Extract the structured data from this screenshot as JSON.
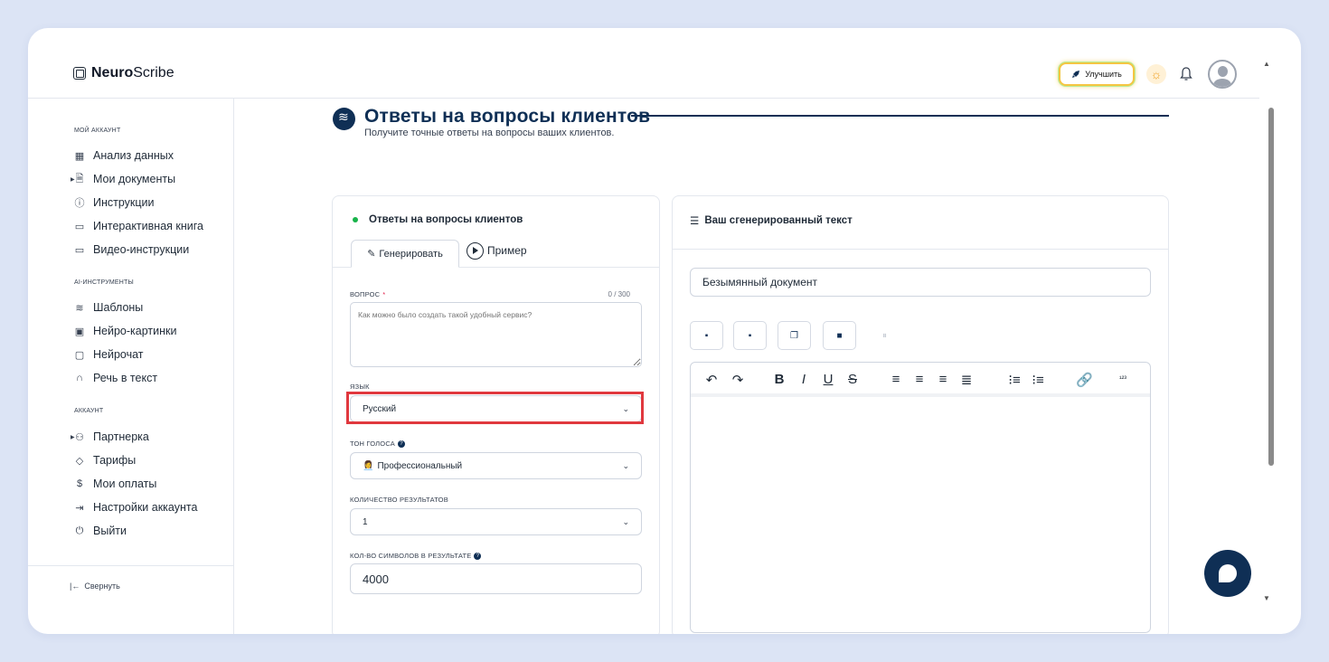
{
  "brand": {
    "bold": "Neuro",
    "light": "Scribe"
  },
  "header": {
    "upgrade_label": "Улучшить"
  },
  "sidebar": {
    "section_account": "МОЙ АККАУНТ",
    "account_items": [
      {
        "label": "Анализ данных",
        "icon": "grid-icon"
      },
      {
        "label": "Мои документы",
        "icon": "document-icon"
      },
      {
        "label": "Инструкции",
        "icon": "help-circle-icon"
      },
      {
        "label": "Интерактивная книга",
        "icon": "book-icon"
      },
      {
        "label": "Видео-инструкции",
        "icon": "video-icon"
      }
    ],
    "section_ai": "AI-ИНСТРУМЕНТЫ",
    "ai_items": [
      {
        "label": "Шаблоны",
        "icon": "layers-icon"
      },
      {
        "label": "Нейро-картинки",
        "icon": "image-icon"
      },
      {
        "label": "Нейрочат",
        "icon": "chat-icon"
      },
      {
        "label": "Речь в текст",
        "icon": "headphones-icon"
      }
    ],
    "section_user": "АККАУНТ",
    "user_items": [
      {
        "label": "Партнерка",
        "icon": "users-icon"
      },
      {
        "label": "Тарифы",
        "icon": "tag-icon"
      },
      {
        "label": "Мои оплаты",
        "icon": "dollar-icon"
      },
      {
        "label": "Настройки аккаунта",
        "icon": "login-icon"
      },
      {
        "label": "Выйти",
        "icon": "power-icon"
      }
    ],
    "collapse_label": "Свернуть"
  },
  "page": {
    "title": "Ответы на вопросы клиентов",
    "subtitle": "Получите точные ответы на вопросы ваших клиентов."
  },
  "form": {
    "card_title": "Ответы на вопросы клиентов",
    "tab_generate": "Генерировать",
    "tab_example": "Пример",
    "question_label": "ВОПРОС",
    "question_required": "*",
    "question_counter": "0 / 300",
    "question_placeholder": "Как можно было создать такой удобный сервис?",
    "language_label": "ЯЗЫК",
    "language_value": "Русский",
    "tone_label": "ТОН ГОЛОСА",
    "tone_value": "Профессиональный",
    "tone_emoji": "👩‍💼",
    "results_label": "КОЛИЧЕСТВО РЕЗУЛЬТАТОВ",
    "results_value": "1",
    "chars_label": "КОЛ-ВО СИМВОЛОВ В РЕЗУЛЬТАТЕ",
    "chars_value": "4000"
  },
  "output": {
    "title": "Ваш сгенерированный текст",
    "doc_name": "Безымянный документ"
  },
  "colors": {
    "accent": "#0f2f55",
    "highlight": "#e0383e",
    "status_dot": "#18b34a"
  }
}
